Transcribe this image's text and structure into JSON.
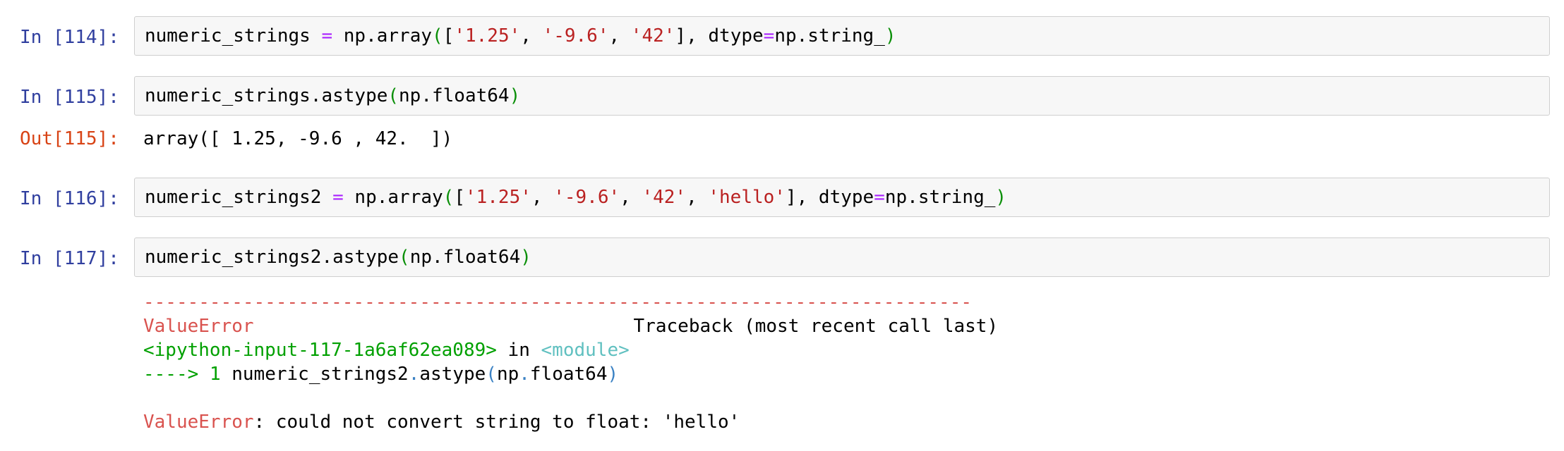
{
  "cells": [
    {
      "in_prompt": "In [114]:",
      "code": {
        "v1": "numeric_strings",
        "eq": "=",
        "call": "np.array",
        "lp": "(",
        "lb": "[",
        "s1": "'1.25'",
        "s2": "'-9.6'",
        "s3": "'42'",
        "rb": "]",
        "kw": "dtype",
        "kwval": "np.string_",
        "rp": ")"
      }
    },
    {
      "in_prompt": "In [115]:",
      "code": {
        "expr": "numeric_strings.astype",
        "lp": "(",
        "arg": "np.float64",
        "rp": ")"
      },
      "out_prompt": "Out[115]:",
      "output": "array([ 1.25, -9.6 , 42.  ])"
    },
    {
      "in_prompt": "In [116]:",
      "code": {
        "v1": "numeric_strings2",
        "eq": "=",
        "call": "np.array",
        "lp": "(",
        "lb": "[",
        "s1": "'1.25'",
        "s2": "'-9.6'",
        "s3": "'42'",
        "s4": "'hello'",
        "rb": "]",
        "kw": "dtype",
        "kwval": "np.string_",
        "rp": ")"
      }
    },
    {
      "in_prompt": "In [117]:",
      "code": {
        "expr": "numeric_strings2.astype",
        "lp": "(",
        "arg": "np.float64",
        "rp": ")"
      },
      "traceback": {
        "rule": "---------------------------------------------------------------------------",
        "error_name": "ValueError",
        "header": "Traceback (most recent call last)",
        "location": "<ipython-input-117-1a6af62ea089>",
        "in_word": " in ",
        "module": "<module>",
        "arrow": "---->",
        "line_no": "1",
        "line_var": "numeric_strings2",
        "line_dot1": ".",
        "line_attr": "astype",
        "line_lp": "(",
        "line_np": "np",
        "line_dot2": ".",
        "line_arg": "float64",
        "line_rp": ")",
        "final_error": "ValueError",
        "final_msg": ": could not convert string to float: 'hello'"
      }
    }
  ]
}
